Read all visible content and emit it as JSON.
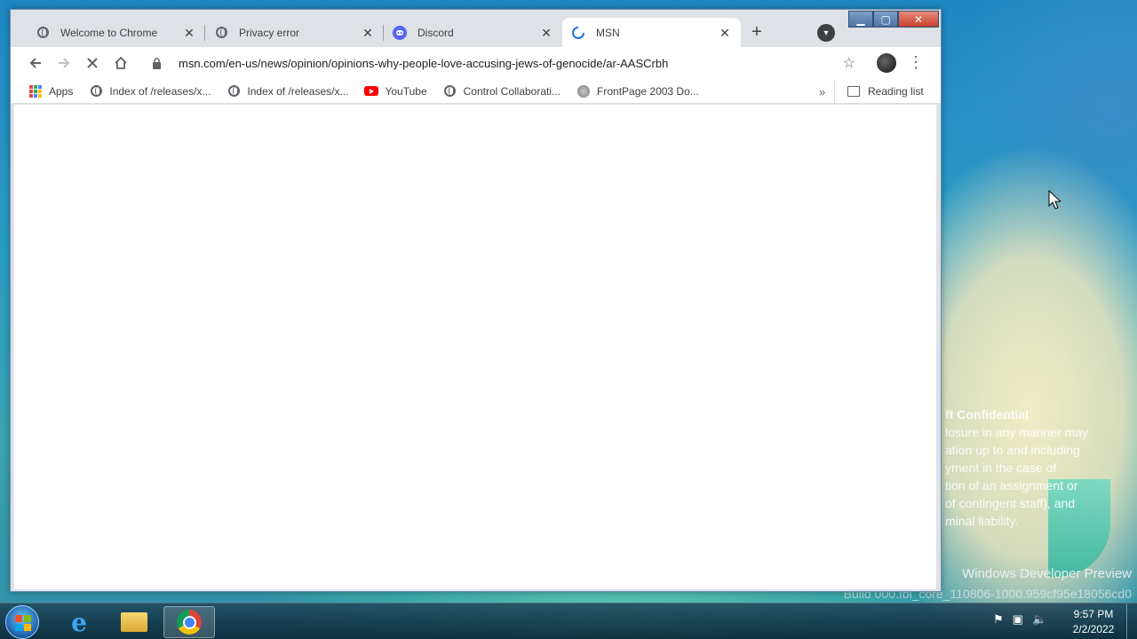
{
  "desktop": {
    "confidential": {
      "title": "ft Confidential",
      "lines": [
        "losure in any manner may",
        "ation up to and including",
        "yment in the case of",
        "tion of an assignment or",
        "of contingent staff), and",
        "minal liability."
      ]
    },
    "watermark": {
      "line1": "Windows Developer Preview",
      "line2": "Build 000.fbl_core_110806-1000.959cf95e18056cd0"
    }
  },
  "browser": {
    "tabs": [
      {
        "title": "Welcome to Chrome",
        "icon": "globe-icon",
        "close": "✕"
      },
      {
        "title": "Privacy error",
        "icon": "globe-icon",
        "close": "✕"
      },
      {
        "title": "Discord",
        "icon": "discord-icon",
        "close": "✕"
      },
      {
        "title": "MSN",
        "icon": "loading-spinner-icon",
        "close": "✕",
        "active": true
      }
    ],
    "new_tab": "+",
    "address": {
      "url": "msn.com/en-us/news/opinion/opinions-why-people-love-accusing-jews-of-genocide/ar-AASCrbh"
    },
    "bookmarks": [
      {
        "label": "Apps",
        "icon": "apps-grid-icon"
      },
      {
        "label": "Index of /releases/x...",
        "icon": "globe-icon"
      },
      {
        "label": "Index of /releases/x...",
        "icon": "globe-icon"
      },
      {
        "label": "YouTube",
        "icon": "youtube-icon"
      },
      {
        "label": "Control Collaborati...",
        "icon": "globe-icon"
      },
      {
        "label": "FrontPage 2003 Do...",
        "icon": "frontpage-icon"
      }
    ],
    "overflow": "»",
    "reading_list": "Reading list"
  },
  "taskbar": {
    "time": "9:57 PM",
    "date": "2/2/2022"
  },
  "colors": {
    "accent": "#1a73e8",
    "tab_bar": "#dee1e6",
    "youtube": "#ff0000",
    "discord": "#5865f2"
  }
}
